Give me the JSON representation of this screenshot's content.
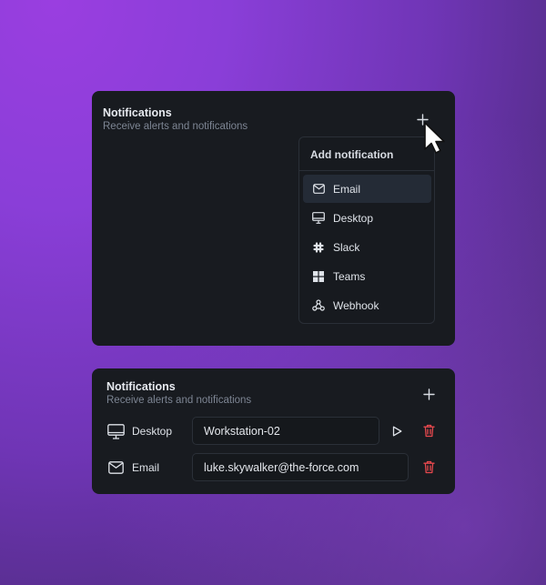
{
  "card1": {
    "title": "Notifications",
    "subtitle": "Receive alerts and notifications",
    "add_icon": "plus-icon",
    "menu": {
      "header": "Add notification",
      "items": [
        {
          "label": "Email",
          "icon": "mail-icon",
          "active": true
        },
        {
          "label": "Desktop",
          "icon": "monitor-icon",
          "active": false
        },
        {
          "label": "Slack",
          "icon": "slack-icon",
          "active": false
        },
        {
          "label": "Teams",
          "icon": "teams-icon",
          "active": false
        },
        {
          "label": "Webhook",
          "icon": "webhook-icon",
          "active": false
        }
      ]
    }
  },
  "card2": {
    "title": "Notifications",
    "subtitle": "Receive alerts and notifications",
    "add_icon": "plus-icon",
    "rows": [
      {
        "label": "Desktop",
        "icon": "monitor-icon",
        "value": "Workstation-02",
        "has_test": true
      },
      {
        "label": "Email",
        "icon": "mail-icon",
        "value": "luke.skywalker@the-force.com",
        "has_test": false
      }
    ]
  },
  "colors": {
    "background_top": "#9a3ee0",
    "card": "#181b20",
    "danger": "#e5484d",
    "menu_active": "#242b36"
  }
}
